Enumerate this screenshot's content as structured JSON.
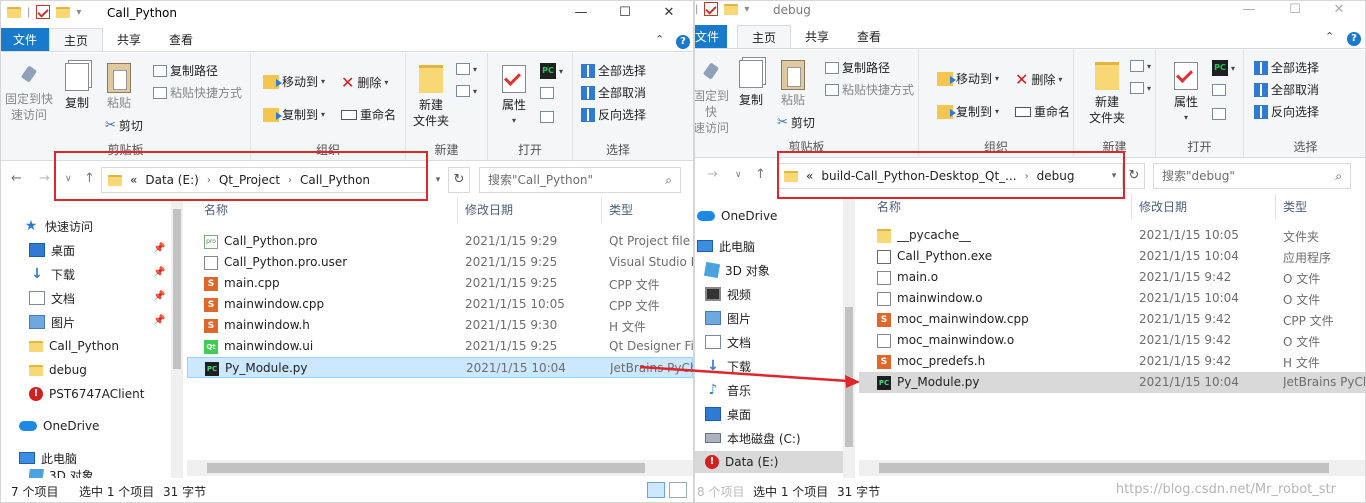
{
  "colors": {
    "accent": "#1979ca",
    "highlight_box": "#e0262d",
    "selected_row": "#cce8ff"
  },
  "left_window": {
    "title": "Call_Python",
    "tabs": [
      "文件",
      "主页",
      "共享",
      "查看"
    ],
    "ribbon": {
      "pin_label_1": "固定到快",
      "pin_label_2": "速访问",
      "copy": "复制",
      "paste": "粘贴",
      "copy_path": "复制路径",
      "paste_shortcut": "粘贴快捷方式",
      "cut": "剪切",
      "move_to": "移动到",
      "copy_to": "复制到",
      "delete": "删除",
      "rename": "重命名",
      "new_folder_1": "新建",
      "new_folder_2": "文件夹",
      "properties": "属性",
      "select_all": "全部选择",
      "select_none": "全部取消",
      "invert": "反向选择",
      "groups": [
        "剪贴板",
        "组织",
        "新建",
        "打开",
        "选择"
      ]
    },
    "address": {
      "prefix": "«",
      "parts": [
        "Data (E:)",
        "Qt_Project",
        "Call_Python"
      ]
    },
    "search_placeholder": "搜索\"Call_Python\"",
    "nav": [
      "快速访问",
      "桌面",
      "下载",
      "文档",
      "图片",
      "Call_Python",
      "debug",
      "PST6747AClient",
      "OneDrive",
      "此电脑",
      "3D 对象"
    ],
    "columns": [
      "名称",
      "修改日期",
      "类型"
    ],
    "files": [
      {
        "name": "Call_Python.pro",
        "date": "2021/1/15 9:29",
        "type": "Qt Project file",
        "icon": "pro-file-icon"
      },
      {
        "name": "Call_Python.pro.user",
        "date": "2021/1/15 9:25",
        "type": "Visual Studio F",
        "icon": "file-icon"
      },
      {
        "name": "main.cpp",
        "date": "2021/1/15 9:25",
        "type": "CPP 文件",
        "icon": "cpp-file-icon"
      },
      {
        "name": "mainwindow.cpp",
        "date": "2021/1/15 10:05",
        "type": "CPP 文件",
        "icon": "cpp-file-icon"
      },
      {
        "name": "mainwindow.h",
        "date": "2021/1/15 9:30",
        "type": "H 文件",
        "icon": "h-file-icon"
      },
      {
        "name": "mainwindow.ui",
        "date": "2021/1/15 9:25",
        "type": "Qt Designer Fi",
        "icon": "qt-designer-icon"
      },
      {
        "name": "Py_Module.py",
        "date": "2021/1/15 10:04",
        "type": "JetBrains PyCh",
        "icon": "pycharm-file-icon"
      }
    ],
    "status": {
      "count": "7 个项目",
      "selected": "选中 1 个项目",
      "size": "31 字节"
    }
  },
  "right_window": {
    "title": "debug",
    "tabs": [
      "文件",
      "主页",
      "共享",
      "查看"
    ],
    "address": {
      "prefix": "«",
      "parts": [
        "build-Call_Python-Desktop_Qt_...",
        "debug"
      ]
    },
    "search_placeholder": "搜索\"debug\"",
    "nav": [
      "OneDrive",
      "此电脑",
      "3D 对象",
      "视频",
      "图片",
      "文档",
      "下载",
      "音乐",
      "桌面",
      "本地磁盘 (C:)",
      "Data (E:)"
    ],
    "columns": [
      "名称",
      "修改日期",
      "类型"
    ],
    "files": [
      {
        "name": "__pycache__",
        "date": "2021/1/15 10:05",
        "type": "文件夹",
        "icon": "folder-icon"
      },
      {
        "name": "Call_Python.exe",
        "date": "2021/1/15 10:04",
        "type": "应用程序",
        "icon": "exe-icon"
      },
      {
        "name": "main.o",
        "date": "2021/1/15 9:42",
        "type": "O 文件",
        "icon": "file-icon"
      },
      {
        "name": "mainwindow.o",
        "date": "2021/1/15 10:04",
        "type": "O 文件",
        "icon": "file-icon"
      },
      {
        "name": "moc_mainwindow.cpp",
        "date": "2021/1/15 9:42",
        "type": "CPP 文件",
        "icon": "cpp-file-icon"
      },
      {
        "name": "moc_mainwindow.o",
        "date": "2021/1/15 9:42",
        "type": "O 文件",
        "icon": "file-icon"
      },
      {
        "name": "moc_predefs.h",
        "date": "2021/1/15 9:42",
        "type": "H 文件",
        "icon": "h-file-icon"
      },
      {
        "name": "Py_Module.py",
        "date": "2021/1/15 10:04",
        "type": "JetBrains PyCh",
        "icon": "pycharm-file-icon"
      }
    ],
    "status": {
      "count": "8 个项目",
      "selected": "选中 1 个项目",
      "size": "31 字节"
    }
  },
  "watermark": "https://blog.csdn.net/Mr_robot_str"
}
